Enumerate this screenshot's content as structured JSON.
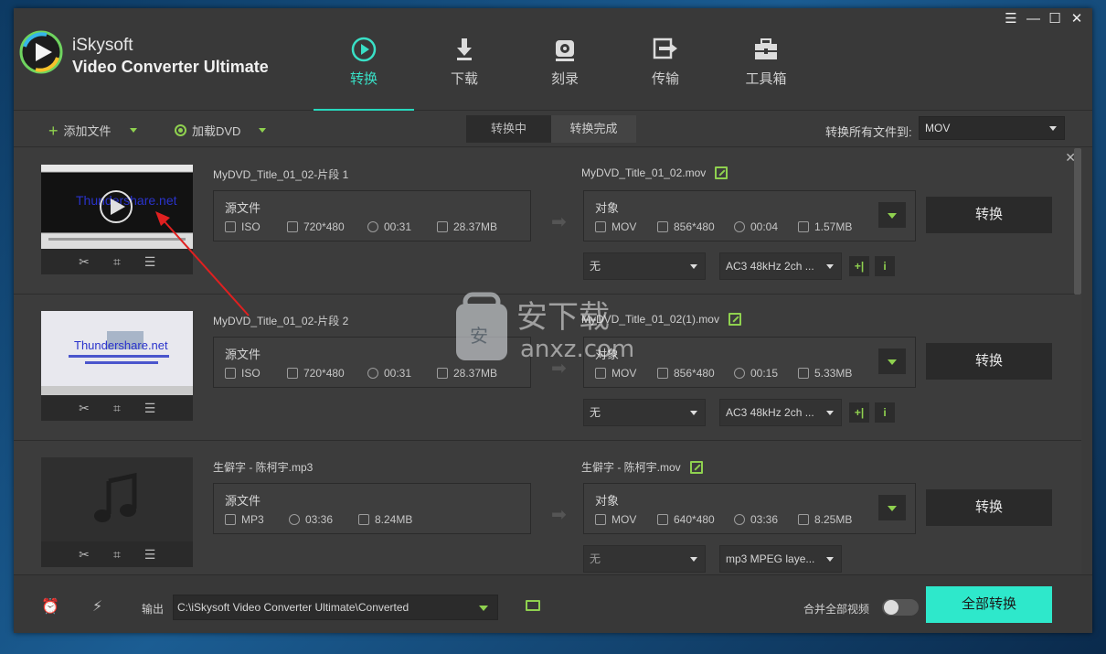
{
  "app": {
    "brand_line1": "iSkysoft",
    "brand_line2": "Video Converter Ultimate",
    "accent": "#2ee8cb",
    "green": "#8fd14f"
  },
  "nav": [
    {
      "label": "转换",
      "icon": "convert-icon",
      "active": true
    },
    {
      "label": "下载",
      "icon": "download-icon",
      "active": false
    },
    {
      "label": "刻录",
      "icon": "burn-disc-icon",
      "active": false
    },
    {
      "label": "传输",
      "icon": "transfer-icon",
      "active": false
    },
    {
      "label": "工具箱",
      "icon": "toolbox-icon",
      "active": false
    }
  ],
  "toolbar": {
    "add_files": "添加文件",
    "load_dvd": "加载DVD",
    "tab_converting": "转换中",
    "tab_converted": "转换完成",
    "convert_all_to": "转换所有文件到:",
    "format": "MOV"
  },
  "files": [
    {
      "src_name": "MyDVD_Title_01_02-片段 1",
      "src_label": "源文件",
      "src": {
        "format": "ISO",
        "resolution": "720*480",
        "duration": "00:31",
        "size": "28.37MB"
      },
      "tgt_name": "MyDVD_Title_01_02.mov",
      "tgt_label": "对象",
      "tgt": {
        "format": "MOV",
        "resolution": "856*480",
        "duration": "00:04",
        "size": "1.57MB"
      },
      "subtitle": "无",
      "audio": "AC3 48kHz 2ch ...",
      "convert": "转换",
      "thumb_text": "Thundershare.net"
    },
    {
      "src_name": "MyDVD_Title_01_02-片段 2",
      "src_label": "源文件",
      "src": {
        "format": "ISO",
        "resolution": "720*480",
        "duration": "00:31",
        "size": "28.37MB"
      },
      "tgt_name": "MyDVD_Title_01_02(1).mov",
      "tgt_label": "对象",
      "tgt": {
        "format": "MOV",
        "resolution": "856*480",
        "duration": "00:15",
        "size": "5.33MB"
      },
      "subtitle": "无",
      "audio": "AC3 48kHz 2ch ...",
      "convert": "转换",
      "thumb_text": "Thundershare.net"
    },
    {
      "src_name": "生僻字 - 陈柯宇.mp3",
      "src_label": "源文件",
      "src": {
        "format": "MP3",
        "duration": "03:36",
        "size": "8.24MB"
      },
      "tgt_name": "生僻字 - 陈柯宇.mov",
      "tgt_label": "对象",
      "tgt": {
        "format": "MOV",
        "resolution": "640*480",
        "duration": "03:36",
        "size": "8.25MB"
      },
      "subtitle": "无",
      "audio": "mp3 MPEG laye...",
      "convert": "转换"
    }
  ],
  "bottom": {
    "output_label": "输出",
    "output_path": "C:\\iSkysoft Video Converter Ultimate\\Converted",
    "merge_label": "合并全部视频",
    "merge_on": false,
    "convert_all": "全部转换"
  },
  "watermark": {
    "line1": "安下载",
    "line2": "anxz.com"
  }
}
